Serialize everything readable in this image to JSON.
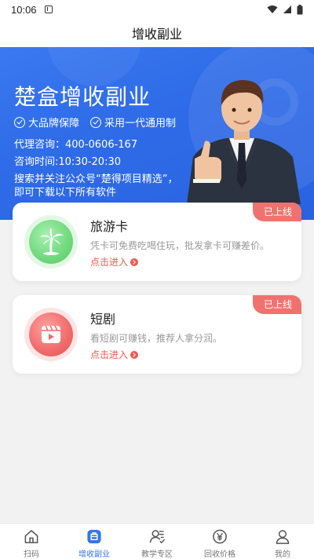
{
  "status_bar": {
    "time": "10:06"
  },
  "title_bar": {
    "title": "增收副业"
  },
  "hero": {
    "title": "楚盒增收副业",
    "badges": [
      "大品牌保障",
      "采用一代通用制"
    ],
    "agent_line": "代理咨询：400-0606-167",
    "hours_line": "咨询时间:10:30-20:30",
    "notice_line1": "搜索并关注公众号“楚得项目精选”，",
    "notice_line2": "即可下载以下所有软件"
  },
  "cards": [
    {
      "tag": "已上线",
      "name": "旅游卡",
      "desc": "凭卡可免费吃喝住玩，批发拿卡可赚差价。",
      "enter": "点击进入",
      "icon": "palm-tree-icon",
      "icon_color": "#6fd97c"
    },
    {
      "tag": "已上线",
      "name": "短剧",
      "desc": "看短剧可赚钱，推荐人拿分润。",
      "enter": "点击进入",
      "icon": "video-play-icon",
      "icon_color": "#f06a6a"
    }
  ],
  "tabbar": {
    "items": [
      {
        "label": "扫码",
        "icon": "home-icon"
      },
      {
        "label": "增收副业",
        "icon": "briefcase-icon",
        "active": true
      },
      {
        "label": "教学专区",
        "icon": "teaching-icon"
      },
      {
        "label": "回收价格",
        "icon": "yen-price-icon"
      },
      {
        "label": "我的",
        "icon": "profile-icon"
      }
    ]
  },
  "colors": {
    "accent": "#3575ea",
    "hero_blue": "#2f6ce8",
    "tag_red": "#f0726f",
    "enter_red": "#ec5a4e"
  }
}
